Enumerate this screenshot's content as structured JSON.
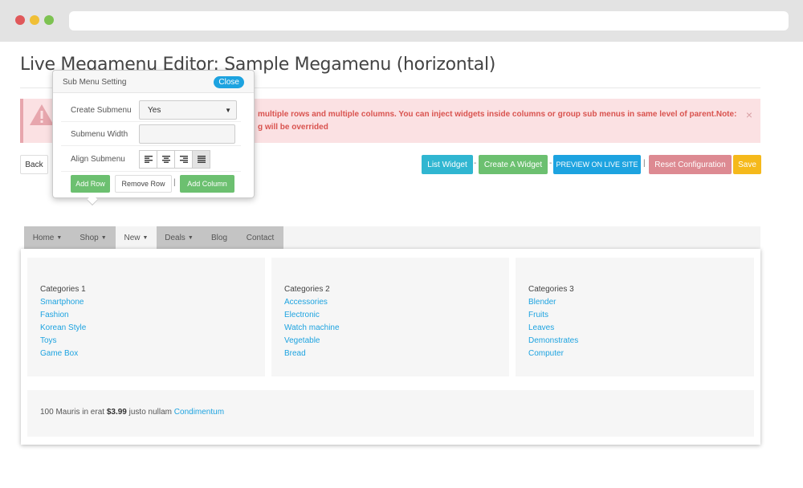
{
  "page": {
    "title": "Live Megamenu Editor: Sample Megamenu (horizontal)"
  },
  "alert": {
    "text": "multiple rows and multiple columns. You can inject widgets inside columns or group sub menus in same level of parent.Note: g will be overrided",
    "line1": "multiple rows and multiple columns. You can inject widgets inside columns or group sub menus in same level of parent.Note:",
    "line2": "g will be overrided",
    "close": "×"
  },
  "toolbar": {
    "back": "Back",
    "list_widget": "List Widget",
    "create_widget": "Create A Widget",
    "preview": "PREVIEW ON LIVE SITE",
    "reset": "Reset Configuration",
    "save": "Save",
    "sep_dash": "-",
    "sep_pipe": "|"
  },
  "popover": {
    "title": "Sub Menu Setting",
    "close": "Close",
    "create_submenu_label": "Create Submenu",
    "create_submenu_value": "Yes",
    "submenu_width_label": "Submenu Width",
    "submenu_width_value": "",
    "align_label": "Align Submenu",
    "align_options": [
      "align-left-icon",
      "align-center-icon",
      "align-right-icon",
      "align-justify-icon"
    ],
    "align_active": "justify",
    "add_row": "Add Row",
    "remove_row": "Remove Row",
    "pipe": "|",
    "add_column": "Add Column"
  },
  "nav": {
    "items": [
      {
        "label": "Home",
        "caret": true
      },
      {
        "label": "Shop",
        "caret": true
      },
      {
        "label": "New",
        "caret": true
      },
      {
        "label": "Deals",
        "caret": true
      },
      {
        "label": "Blog",
        "caret": false
      },
      {
        "label": "Contact",
        "caret": false
      }
    ]
  },
  "dropdown": {
    "columns": [
      {
        "title": "Categories 1",
        "links": [
          "Smartphone",
          "Fashion",
          "Korean Style",
          "Toys",
          "Game Box"
        ]
      },
      {
        "title": "Categories 2",
        "links": [
          "Accessories",
          "Electronic",
          "Watch machine",
          "Vegetable",
          "Bread"
        ]
      },
      {
        "title": "Categories 3",
        "links": [
          "Blender",
          "Fruits",
          "Leaves",
          "Demonstrates",
          "Computer"
        ]
      }
    ],
    "bottom": {
      "prefix": "100 Mauris in erat",
      "price": "$3.99",
      "middle": "justo nullam",
      "link": "Condimentum"
    }
  },
  "colors": {
    "accent_blue": "#1da3e0",
    "green": "#6cc070",
    "cyan": "#30b6d1",
    "reset_pink": "#dd8a92",
    "save_yellow": "#f5b91b",
    "alert_bg": "#fbe1e3",
    "alert_text": "#d9534f"
  }
}
